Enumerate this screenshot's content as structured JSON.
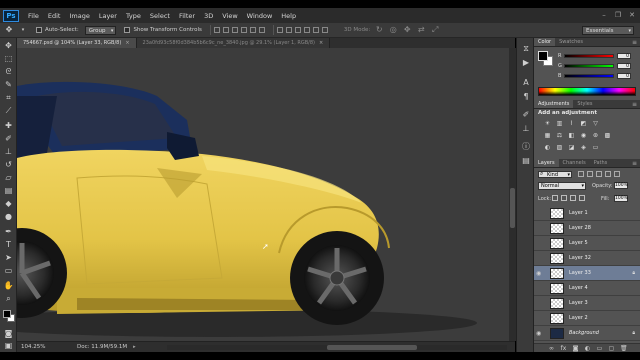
{
  "app": {
    "logo": "Ps"
  },
  "menu": [
    "File",
    "Edit",
    "Image",
    "Layer",
    "Type",
    "Select",
    "Filter",
    "3D",
    "View",
    "Window",
    "Help"
  ],
  "options_bar": {
    "auto_select_label": "Auto-Select:",
    "auto_select_value": "Group",
    "show_transform_label": "Show Transform Controls",
    "mode_3d_label": "3D Mode:",
    "workspace": "Essentials"
  },
  "documents": [
    {
      "title": "754667.psd @ 104% (Layer 33, RGB/8)",
      "close": "×"
    },
    {
      "title": "23a0fd93c58f0d384b5b6c9c_ne_3840.jpg @ 29.1% (Layer 1, RGB/8)",
      "close": "×"
    }
  ],
  "status": {
    "zoom": "104.25%",
    "doc": "Doc: 11.9M/59.1M",
    "arrow": "▸"
  },
  "color_panel": {
    "tabs": [
      "Color",
      "Swatches"
    ],
    "sliders": [
      {
        "label": "R",
        "value": "0",
        "gradient": [
          "#000000",
          "#ff0000"
        ]
      },
      {
        "label": "G",
        "value": "0",
        "gradient": [
          "#000000",
          "#00ff00"
        ]
      },
      {
        "label": "B",
        "value": "0",
        "gradient": [
          "#000000",
          "#0000ff"
        ]
      }
    ]
  },
  "adjustments_panel": {
    "tabs": [
      "Adjustments",
      "Styles"
    ],
    "title": "Add an adjustment"
  },
  "layers_panel": {
    "tabs": [
      "Layers",
      "Channels",
      "Paths"
    ],
    "kind": "Kind",
    "blend_mode": "Normal",
    "opacity_label": "Opacity:",
    "opacity_value": "100%",
    "fill_label": "Fill:",
    "fill_value": "100%",
    "lock_label": "Lock:",
    "layers": [
      {
        "name": "Layer 1",
        "visible": false,
        "selected": false
      },
      {
        "name": "Layer 28",
        "visible": false,
        "selected": false
      },
      {
        "name": "Layer 5",
        "visible": false,
        "selected": false
      },
      {
        "name": "Layer 32",
        "visible": false,
        "selected": false
      },
      {
        "name": "Layer 33",
        "visible": true,
        "selected": true
      },
      {
        "name": "Layer 4",
        "visible": false,
        "selected": false
      },
      {
        "name": "Layer 3",
        "visible": false,
        "selected": false
      },
      {
        "name": "Layer 2",
        "visible": false,
        "selected": false
      },
      {
        "name": "Background",
        "visible": true,
        "selected": false,
        "locked": true
      }
    ]
  },
  "colors": {
    "car_body": "#e6c84a",
    "ui_dark": "#2b2b2b",
    "selection": "#6e7d96"
  }
}
